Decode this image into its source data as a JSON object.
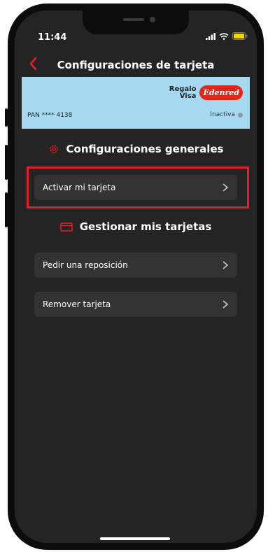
{
  "status_bar": {
    "time": "11:44"
  },
  "header": {
    "title": "Configuraciones de tarjeta"
  },
  "card": {
    "brand_line1": "Regalo",
    "brand_line2": "Visa",
    "brand_logo": "Edenred",
    "pan": "PAN **** 4138",
    "status": "Inactiva"
  },
  "sections": {
    "general": {
      "title": "Configuraciones generales",
      "icon": "gear-icon"
    },
    "manage": {
      "title": "Gestionar mis tarjetas",
      "icon": "card-icon"
    }
  },
  "rows": {
    "activate": "Activar mi tarjeta",
    "replacement": "Pedir una reposición",
    "remove": "Remover tarjeta"
  },
  "colors": {
    "accent": "#e41e2a",
    "card_bg": "#a6d9f1",
    "screen_bg": "#242424",
    "row_bg": "#333333"
  }
}
